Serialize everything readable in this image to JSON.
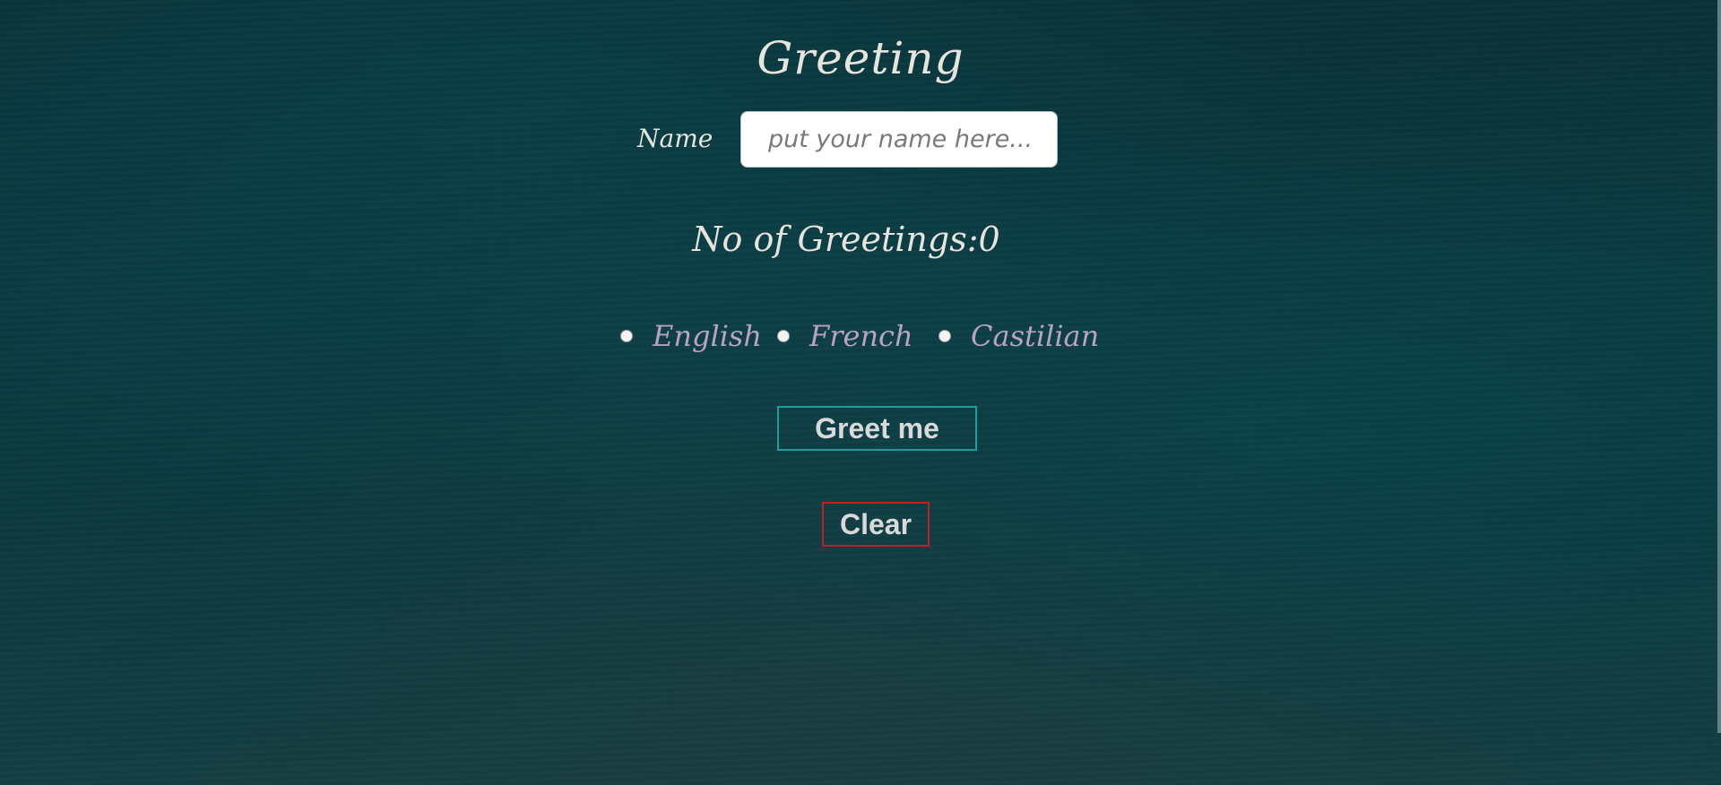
{
  "title": "Greeting",
  "name_field": {
    "label": "Name",
    "value": "",
    "placeholder": "put your name here..."
  },
  "counter": {
    "text": "No of Greetings:0"
  },
  "languages": [
    {
      "label": "English",
      "selected": false
    },
    {
      "label": "French",
      "selected": false
    },
    {
      "label": "Castilian",
      "selected": false
    }
  ],
  "buttons": {
    "greet_label": "Greet me",
    "clear_label": "Clear"
  },
  "colors": {
    "background": "#0b3a40",
    "text": "#e6e4dc",
    "language_text": "#b9a2c6",
    "greet_border": "#1f9c9c",
    "clear_border": "#c0201f"
  }
}
